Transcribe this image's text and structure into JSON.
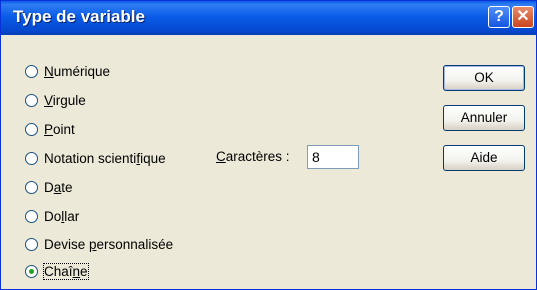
{
  "dialog": {
    "title": "Type de variable",
    "help_symbol": "?",
    "close_symbol": "✕"
  },
  "options": [
    {
      "pre": "",
      "u": "N",
      "post": "umérique",
      "checked": false
    },
    {
      "pre": "",
      "u": "V",
      "post": "irgule",
      "checked": false
    },
    {
      "pre": "",
      "u": "P",
      "post": "oint",
      "checked": false
    },
    {
      "pre": "Notation scienti",
      "u": "f",
      "post": "ique",
      "checked": false
    },
    {
      "pre": "D",
      "u": "a",
      "post": "te",
      "checked": false
    },
    {
      "pre": "Do",
      "u": "l",
      "post": "lar",
      "checked": false
    },
    {
      "pre": "Devise ",
      "u": "p",
      "post": "ersonnalisée",
      "checked": false
    },
    {
      "pre": "Chaî",
      "u": "n",
      "post": "e",
      "checked": true
    }
  ],
  "characters": {
    "label_u": "C",
    "label_rest": "aractères :",
    "value": "8"
  },
  "buttons": {
    "ok": "OK",
    "cancel": "Annuler",
    "help": "Aide"
  }
}
